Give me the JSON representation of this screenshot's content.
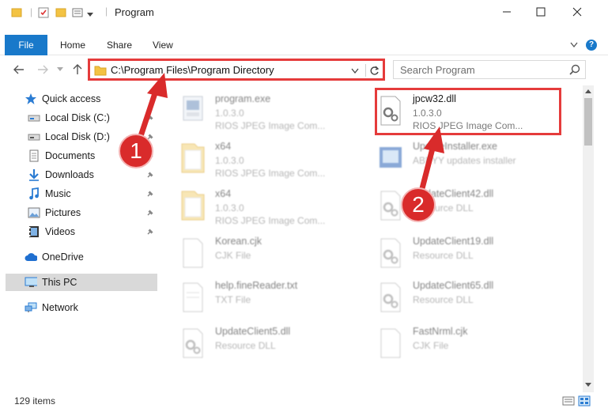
{
  "window": {
    "title": "Program",
    "controls": [
      "minimize-icon",
      "maximize-icon",
      "close-icon"
    ]
  },
  "ribbon": {
    "tabs": [
      {
        "label": "File",
        "active": true
      },
      {
        "label": "Home"
      },
      {
        "label": "Share"
      },
      {
        "label": "View"
      }
    ],
    "accent": "#1979ca"
  },
  "nav": {
    "address_path": "C:\\Program Files\\Program Directory",
    "search_placeholder": "Search Program"
  },
  "sidebar": {
    "items": [
      {
        "label": "Quick access",
        "icon": "star-icon",
        "pinned": false
      },
      {
        "label": "Local Disk (C:)",
        "icon": "drive-icon",
        "pinned": true
      },
      {
        "label": "Local Disk (D:)",
        "icon": "drive-icon",
        "pinned": true
      },
      {
        "label": "Documents",
        "icon": "documents-icon",
        "pinned": true
      },
      {
        "label": "Downloads",
        "icon": "download-icon",
        "pinned": true
      },
      {
        "label": "Music",
        "icon": "music-icon",
        "pinned": true
      },
      {
        "label": "Pictures",
        "icon": "pictures-icon",
        "pinned": true
      },
      {
        "label": "Videos",
        "icon": "videos-icon",
        "pinned": true
      },
      {
        "label": "OneDrive",
        "icon": "cloud-icon",
        "pinned": false
      },
      {
        "label": "This PC",
        "icon": "pc-icon",
        "pinned": false,
        "selected": true
      },
      {
        "label": "Network",
        "icon": "network-icon",
        "pinned": false
      }
    ]
  },
  "files": {
    "left": [
      {
        "name": "program.exe",
        "line2": "1.0.3.0",
        "line3": "RIOS JPEG Image Com...",
        "icon": "exe-icon"
      },
      {
        "name": "x64",
        "line2": "1.0.3.0",
        "line3": "RIOS JPEG Image Com...",
        "icon": "folder-icon"
      },
      {
        "name": "x64",
        "line2": "1.0.3.0",
        "line3": "RIOS JPEG Image Com...",
        "icon": "folder-icon"
      },
      {
        "name": "Korean.cjk",
        "line2": "CJK File",
        "line3": "",
        "icon": "file-icon"
      },
      {
        "name": "help.fineReader.txt",
        "line2": "TXT File",
        "line3": "",
        "icon": "file-icon"
      },
      {
        "name": "UpdateClient5.dll",
        "line2": "Resource DLL",
        "line3": "",
        "icon": "dll-icon"
      }
    ],
    "right": [
      {
        "name": "jpcw32.dll",
        "line2": "1.0.3.0",
        "line3": "RIOS JPEG Image Com...",
        "icon": "dll-icon",
        "highlighted": true
      },
      {
        "name": "UpdateInstaller.exe",
        "line2": "ABBYY updates installer",
        "line3": "",
        "icon": "installer-icon"
      },
      {
        "name": "UpdateClient42.dll",
        "line2": "Resource DLL",
        "line3": "",
        "icon": "dll-icon"
      },
      {
        "name": "UpdateClient19.dll",
        "line2": "Resource DLL",
        "line3": "",
        "icon": "dll-icon"
      },
      {
        "name": "UpdateClient65.dll",
        "line2": "Resource DLL",
        "line3": "",
        "icon": "dll-icon"
      },
      {
        "name": "FastNrml.cjk",
        "line2": "CJK File",
        "line3": "",
        "icon": "file-icon"
      }
    ]
  },
  "status": {
    "item_count": "129 items"
  },
  "annotations": {
    "callout_1": "1",
    "callout_2": "2",
    "color": "#e53b3b"
  }
}
